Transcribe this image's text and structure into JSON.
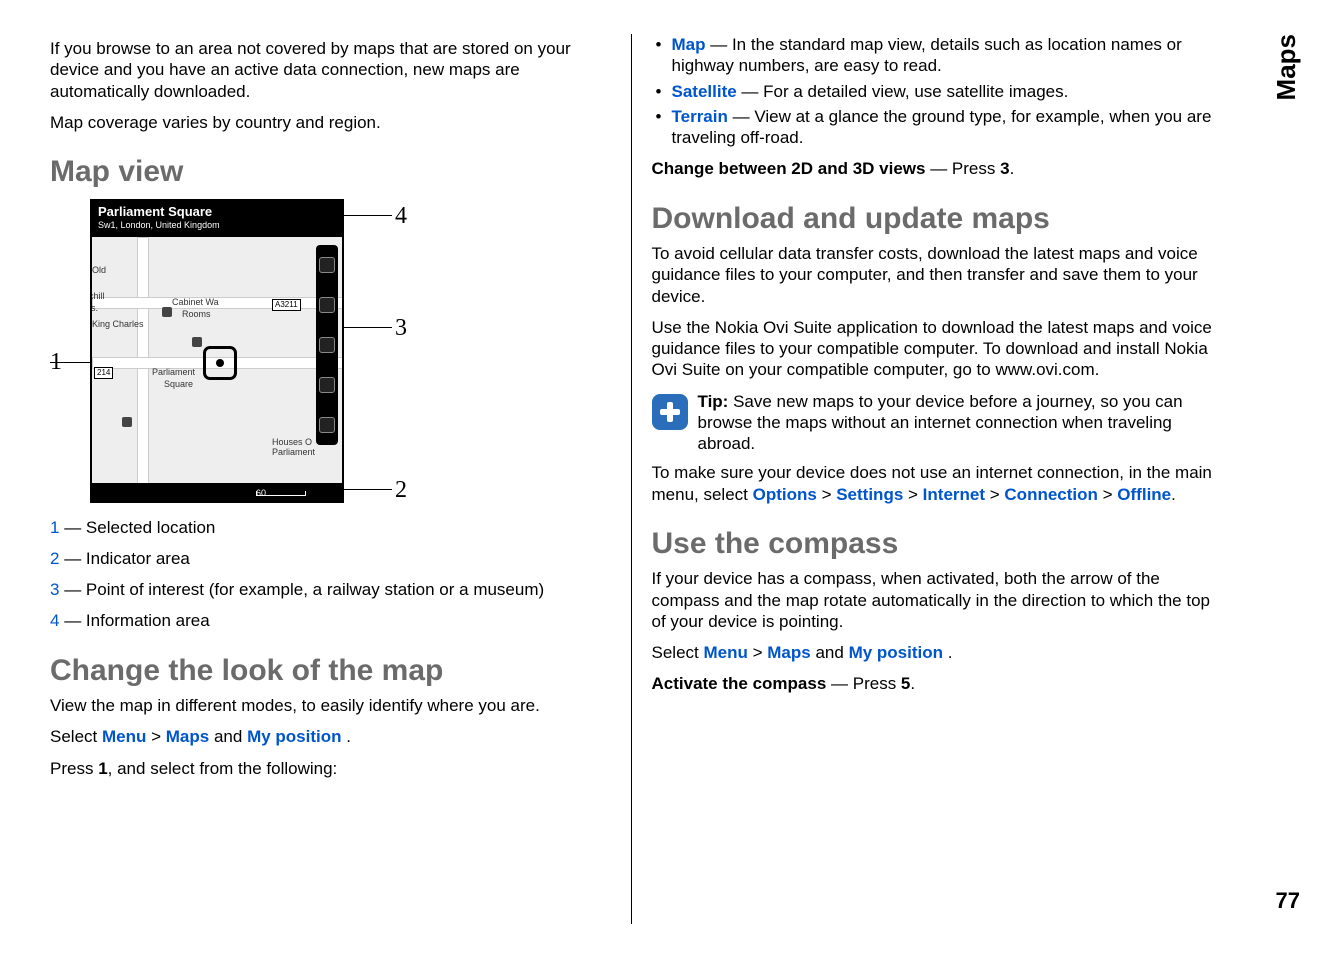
{
  "sideTab": "Maps",
  "pageNumber": "77",
  "left": {
    "intro1": "If you browse to an area not covered by maps that are stored on your device and you have an active data connection, new maps are automatically downloaded.",
    "intro2": "Map coverage varies by country and region.",
    "mapViewHeading": "Map view",
    "figure": {
      "headerTitle": "Parliament Square",
      "headerSub": "Sw1, London, United Kingdom",
      "labels": {
        "old": "Old",
        "rchill": "rchill",
        "us": "us.",
        "king": "King Charles",
        "cabinet": "Cabinet Wa",
        "rooms": "Rooms",
        "a3211": "A3211",
        "n214": "214",
        "parliament": "Parliament",
        "square": "Square",
        "houses": "Houses O",
        "parl": "Parliament"
      },
      "scale": "60",
      "callouts": {
        "c1": "1",
        "c2": "2",
        "c3": "3",
        "c4": "4"
      }
    },
    "legend": {
      "n1": "1",
      "t1": " — Selected location",
      "n2": "2",
      "t2": " — Indicator area",
      "n3": "3",
      "t3": " — Point of interest (for example, a railway station or a museum)",
      "n4": "4",
      "t4": " — Information area"
    },
    "changeLookHeading": "Change the look of the map",
    "changeLookP1": "View the map in different modes, to easily identify where you are.",
    "selectWord": "Select ",
    "menu": "Menu",
    "gt": " > ",
    "maps": "Maps",
    "andWord": " and ",
    "myPosition": "My position",
    "period": ".",
    "press1Pre": "Press ",
    "press1Key": "1",
    "press1Post": ", and select from the following:"
  },
  "right": {
    "options": [
      {
        "term": "Map",
        "desc": "  — In the standard map view, details such as location names or highway numbers, are easy to read."
      },
      {
        "term": "Satellite",
        "desc": "  — For a detailed view, use satellite images."
      },
      {
        "term": "Terrain",
        "desc": "  — View at a glance the ground type, for example, when you are traveling off-road."
      }
    ],
    "change2d3d": {
      "label": "Change between 2D and 3D views",
      "dash": " —  Press ",
      "key": "3",
      "end": "."
    },
    "downloadHeading": "Download and update maps",
    "dl1": "To avoid cellular data transfer costs, download the latest maps and voice guidance files to your computer, and then transfer and save them to your device.",
    "dl2": "Use the Nokia Ovi Suite application to download the latest maps and voice guidance files to your compatible computer. To download and install Nokia Ovi Suite on your compatible computer, go to www.ovi.com.",
    "tipLabel": "Tip:",
    "tipText": " Save new maps to your device before a journey, so you can browse the maps without an internet connection when traveling abroad.",
    "offlinePre": "To make sure your device does not use an internet connection, in the main menu, select ",
    "pathOptions": "Options",
    "pathSettings": "Settings",
    "pathInternet": "Internet",
    "pathConnection": "Connection",
    "pathOffline": "Offline",
    "compassHeading": "Use the compass",
    "compassP1": "If your device has a compass, when activated, both the arrow of the compass and the map rotate automatically in the direction to which the top of your device is pointing.",
    "activate": {
      "label": "Activate the compass",
      "dash": " —  Press ",
      "key": "5",
      "end": "."
    }
  }
}
